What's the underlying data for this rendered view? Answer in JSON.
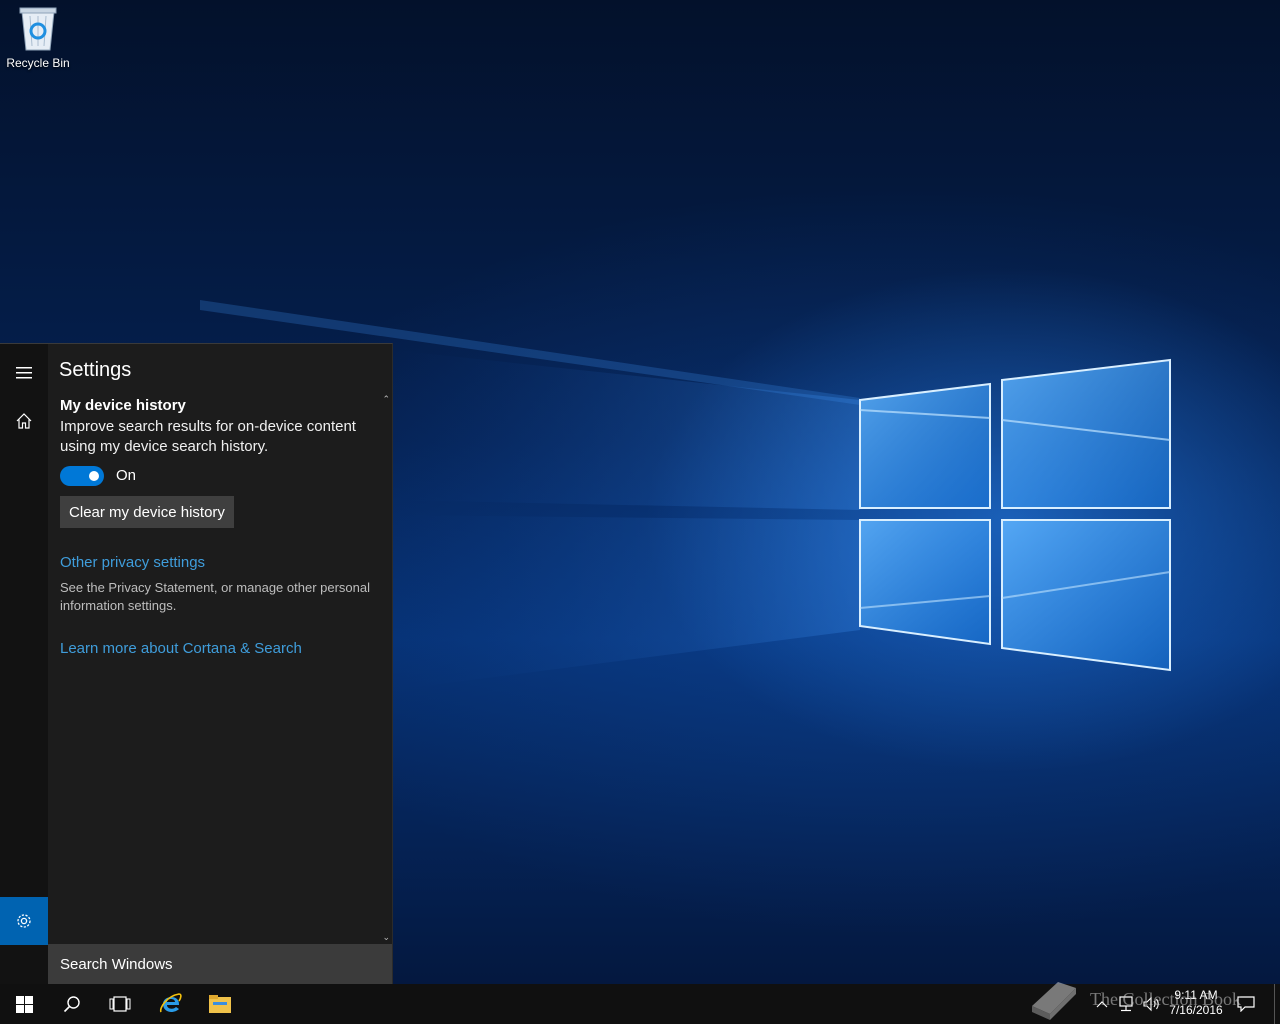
{
  "desktop": {
    "icons": [
      {
        "label": "Recycle Bin"
      }
    ]
  },
  "panel": {
    "title": "Settings",
    "rail": {
      "menu_icon": "hamburger-icon",
      "home_icon": "home-icon",
      "settings_icon": "gear-icon"
    },
    "device_history": {
      "heading": "My device history",
      "description": "Improve search results for on-device content using my device search history.",
      "toggle_state": "On",
      "toggle_on": true,
      "clear_button": "Clear my device history"
    },
    "privacy": {
      "link": "Other privacy settings",
      "description": "See the Privacy Statement, or manage other personal information settings."
    },
    "learn_more_link": "Learn more about Cortana & Search",
    "search_box": "Search Windows"
  },
  "taskbar": {
    "buttons": [
      "windows-logo-icon",
      "search-icon",
      "task-view-icon",
      "internet-explorer-icon",
      "file-explorer-icon"
    ],
    "tray": {
      "time": "9:11 AM",
      "date": "7/16/2016",
      "icons": [
        "chevron-up-icon",
        "network-icon",
        "volume-icon",
        "action-center-icon"
      ]
    }
  },
  "watermark": {
    "text": "The Collection Book"
  },
  "colors": {
    "accent": "#0078d7",
    "link": "#3f9ddb",
    "panel_bg": "#1c1c1c",
    "taskbar_bg": "#101010"
  }
}
